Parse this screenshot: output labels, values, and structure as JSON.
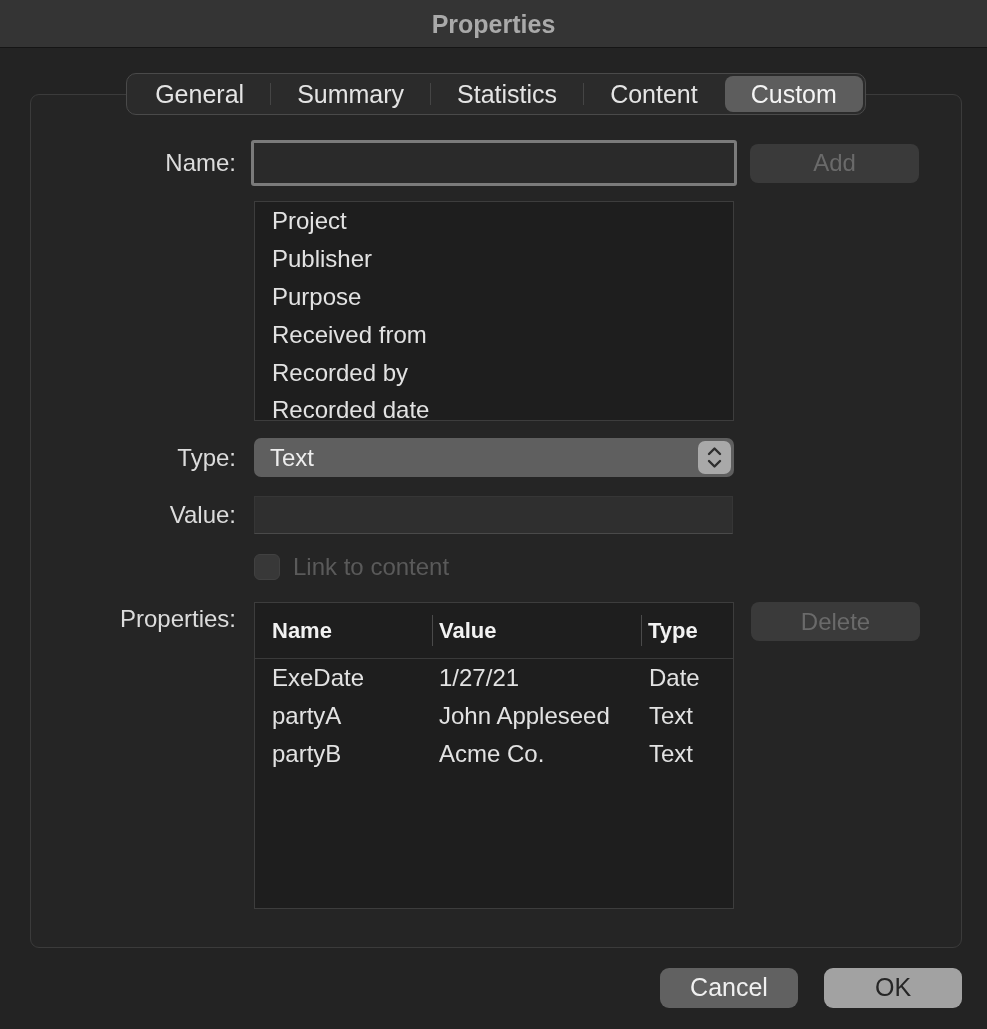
{
  "window": {
    "title": "Properties"
  },
  "tabs": [
    {
      "label": "General",
      "selected": false
    },
    {
      "label": "Summary",
      "selected": false
    },
    {
      "label": "Statistics",
      "selected": false
    },
    {
      "label": "Content",
      "selected": false
    },
    {
      "label": "Custom",
      "selected": true
    }
  ],
  "name_field": {
    "label": "Name:",
    "focused": true
  },
  "add_button": {
    "label": "Add",
    "disabled": true
  },
  "name_list": [
    {
      "label": "Project",
      "selected": false
    },
    {
      "label": "Publisher",
      "selected": false
    },
    {
      "label": "Purpose",
      "selected": false
    },
    {
      "label": "Received from",
      "selected": false
    },
    {
      "label": "Recorded by",
      "selected": false
    },
    {
      "label": "Recorded date",
      "selected": false
    }
  ],
  "type_field": {
    "label": "Type:",
    "value": "Text"
  },
  "value_field": {
    "label": "Value:"
  },
  "link_checkbox": {
    "label": "Link to content",
    "checked": false,
    "disabled": true
  },
  "properties": {
    "label": "Properties:",
    "columns": [
      "Name",
      "Value",
      "Type"
    ],
    "rows": [
      [
        "ExeDate",
        "1/27/21",
        "Date"
      ],
      [
        "partyA",
        "John Appleseed",
        "Text"
      ],
      [
        "partyB",
        "Acme Co.",
        "Text"
      ]
    ]
  },
  "delete_button": {
    "label": "Delete",
    "disabled": true
  },
  "buttons": [
    {
      "label": "Cancel",
      "kind": "normal"
    },
    {
      "label": "OK",
      "kind": "default"
    }
  ]
}
